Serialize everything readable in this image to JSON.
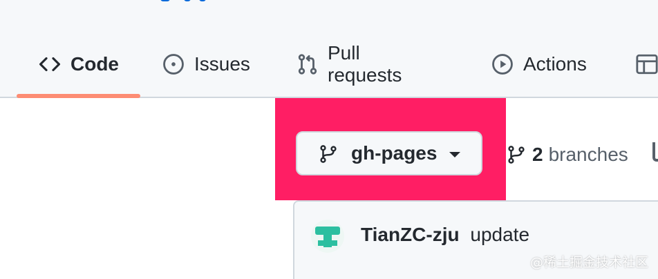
{
  "colors": {
    "accent_underline": "#fd8c73",
    "highlight_box": "#ff1e64",
    "link_blue": "#0969da",
    "text": "#24292f",
    "muted": "#57606a",
    "avatar_green": "#2cbfa0"
  },
  "nav": {
    "tabs": [
      {
        "label": "Code",
        "icon": "code-icon",
        "selected": true
      },
      {
        "label": "Issues",
        "icon": "issue-opened-icon"
      },
      {
        "label": "Pull requests",
        "icon": "git-pull-request-icon"
      },
      {
        "label": "Actions",
        "icon": "play-icon"
      },
      {
        "label": "",
        "icon": "table-icon"
      }
    ]
  },
  "branch_selector": {
    "label": "gh-pages",
    "icon": "git-branch-icon",
    "caret_icon": "triangle-down-icon"
  },
  "branches": {
    "count": "2",
    "label": "branches",
    "icon": "git-branch-icon"
  },
  "commit": {
    "author": "TianZC-zju",
    "message": "update",
    "avatar_icon": "identicon-avatar"
  },
  "watermark": "@稀土掘金技术社区"
}
